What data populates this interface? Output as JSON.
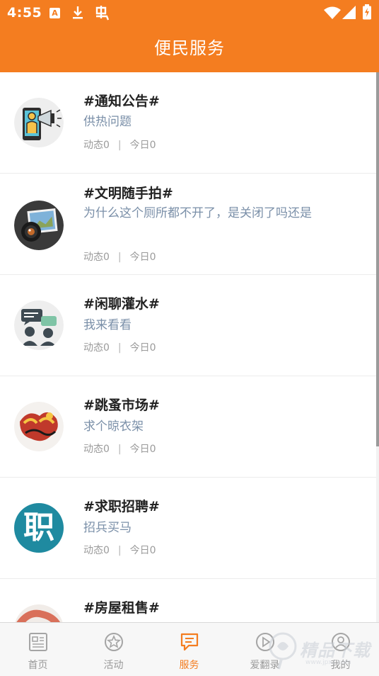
{
  "status_bar": {
    "time": "4:55",
    "icons": [
      "app-a-icon",
      "download-icon",
      "notification-app-icon",
      "wifi-icon",
      "signal-icon",
      "battery-icon"
    ]
  },
  "header": {
    "title": "便民服务",
    "color": "#f47d20"
  },
  "items": [
    {
      "title": "#通知公告#",
      "desc": "供热问题",
      "meta_posts": "动态0",
      "meta_today": "今日0",
      "icon": "megaphone-icon"
    },
    {
      "title": "#文明随手拍#",
      "desc": "为什么这个厕所都不开了，是关闭了吗还是",
      "meta_posts": "动态0",
      "meta_today": "今日0",
      "icon": "camera-icon"
    },
    {
      "title": "#闲聊灌水#",
      "desc": "我来看看",
      "meta_posts": "动态0",
      "meta_today": "今日0",
      "icon": "chat-people-icon"
    },
    {
      "title": "#跳蚤市场#",
      "desc": "求个晾衣架",
      "meta_posts": "动态0",
      "meta_today": "今日0",
      "icon": "flea-market-logo-icon"
    },
    {
      "title": "#求职招聘#",
      "desc": "招兵买马",
      "meta_posts": "动态0",
      "meta_today": "今日0",
      "icon": "job-icon",
      "icon_text": "职"
    },
    {
      "title": "#房屋租售#",
      "icon": "house-icon"
    }
  ],
  "tabbar": {
    "tabs": [
      {
        "label": "首页",
        "icon": "home-icon",
        "active": false
      },
      {
        "label": "活动",
        "icon": "activity-icon",
        "active": false
      },
      {
        "label": "服务",
        "icon": "service-icon",
        "active": true
      },
      {
        "label": "爱翻录",
        "icon": "play-icon",
        "active": false
      },
      {
        "label": "我的",
        "icon": "profile-icon",
        "active": false
      }
    ]
  },
  "watermark": {
    "text": "精品下载",
    "url": "www.jpxz.com"
  }
}
